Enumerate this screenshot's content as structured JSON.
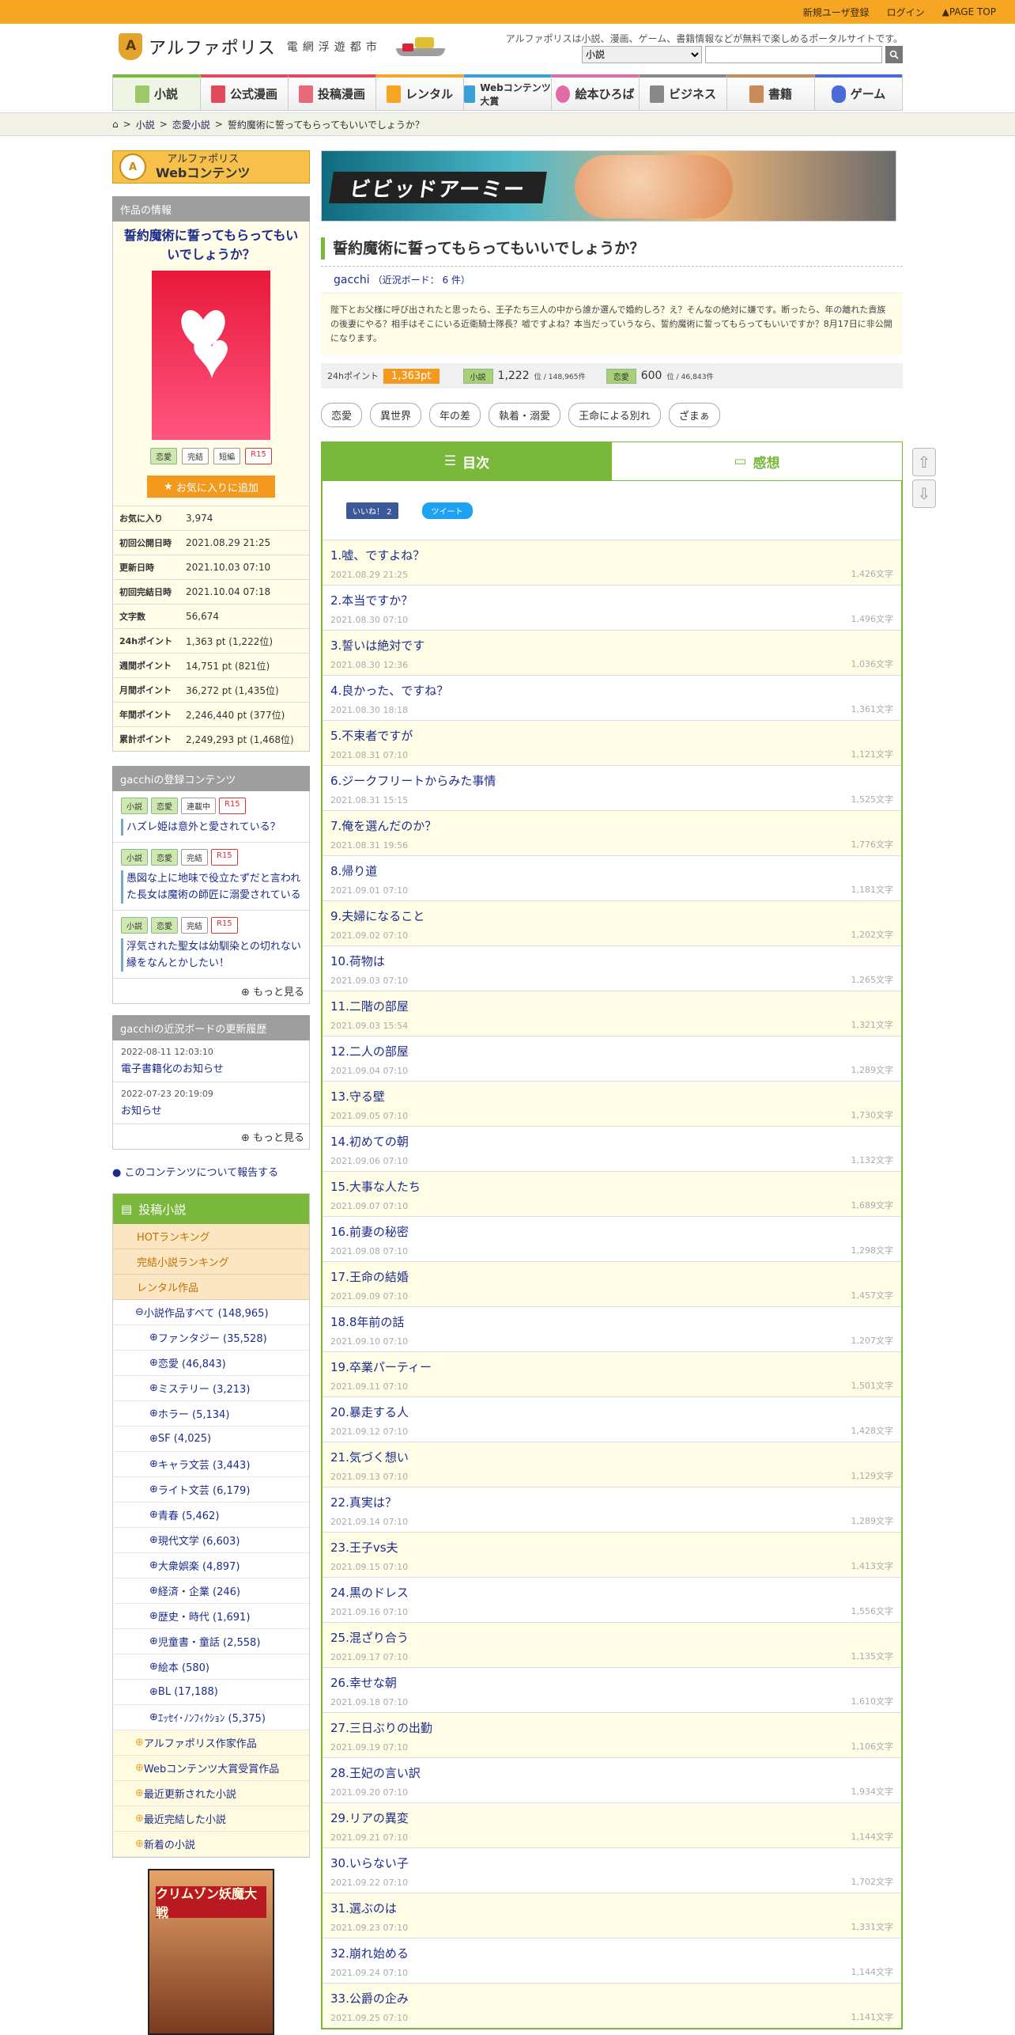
{
  "topbar": {
    "register": "新規ユーザ登録",
    "login": "ログイン",
    "pagetop": "PAGE TOP"
  },
  "header": {
    "logo_name": "アルファポリス",
    "logo_sub": "電網浮遊都市",
    "tagline": "アルファポリスは小説、漫画、ゲーム、書籍情報などが無料で楽しめるポータルサイトです。",
    "search_select": "小説",
    "search_placeholder": ""
  },
  "gnav": [
    "小説",
    "公式漫画",
    "投稿漫画",
    "レンタル",
    "Webコンテンツ大賞",
    "絵本ひろば",
    "ビジネス",
    "書籍",
    "ゲーム"
  ],
  "breadcrumb": {
    "sep": ">",
    "items": [
      "小説",
      "恋愛小説",
      "誓約魔術に誓ってもらってもいいでしょうか？"
    ]
  },
  "left": {
    "webcontents": {
      "line1": "アルファポリス",
      "line2": "Webコンテンツ"
    },
    "info_head": "作品の情報",
    "title": "誓約魔術に誓ってもらってもいいでしょうか？",
    "tags": [
      "恋愛",
      "完結",
      "短編",
      "R15"
    ],
    "fav_button": "お気に入りに追加",
    "stats": [
      {
        "k": "お気に入り",
        "v": "3,974"
      },
      {
        "k": "初回公開日時",
        "v": "2021.08.29 21:25"
      },
      {
        "k": "更新日時",
        "v": "2021.10.03 07:10"
      },
      {
        "k": "初回完結日時",
        "v": "2021.10.04 07:18"
      },
      {
        "k": "文字数",
        "v": "56,674"
      },
      {
        "k": "24hポイント",
        "v": "1,363 pt (1,222位)"
      },
      {
        "k": "週間ポイント",
        "v": "14,751 pt (821位)"
      },
      {
        "k": "月間ポイント",
        "v": "36,272 pt (1,435位)"
      },
      {
        "k": "年間ポイント",
        "v": "2,246,440 pt (377位)"
      },
      {
        "k": "累計ポイント",
        "v": "2,249,293 pt (1,468位)"
      }
    ],
    "reg_head": "gacchiの登録コンテンツ",
    "reg": [
      {
        "tags": [
          "小説",
          "恋愛",
          "連載中",
          "R15"
        ],
        "title": "ハズレ姫は意外と愛されている？"
      },
      {
        "tags": [
          "小説",
          "恋愛",
          "完結",
          "R15"
        ],
        "title": "愚図な上に地味で役立たずだと言われた長女は魔術の師匠に溺愛されている"
      },
      {
        "tags": [
          "小説",
          "恋愛",
          "完結",
          "R15"
        ],
        "title": "浮気された聖女は幼馴染との切れない縁をなんとかしたい！"
      }
    ],
    "more": "もっと見る",
    "bb_head": "gacchiの近況ボードの更新履歴",
    "bb": [
      {
        "d": "2022-08-11 12:03:10",
        "t": "電子書籍化のお知らせ"
      },
      {
        "d": "2022-07-23 20:19:09",
        "t": "お知らせ"
      }
    ],
    "report": "このコンテンツについて報告する",
    "nov_head": "投稿小説",
    "ranks": [
      "HOTランキング",
      "完結小説ランキング",
      "レンタル作品"
    ],
    "all": "小説作品すべて (148,965)",
    "cats": [
      "ファンタジー (35,528)",
      "恋愛 (46,843)",
      "ミステリー (3,213)",
      "ホラー (5,134)",
      "SF (4,025)",
      "キャラ文芸 (3,443)",
      "ライト文芸 (6,179)",
      "青春 (5,462)",
      "現代文学 (6,603)",
      "大衆娯楽 (4,897)",
      "経済・企業 (246)",
      "歴史・時代 (1,691)",
      "児童書・童話 (2,558)",
      "絵本 (580)",
      "BL (17,188)",
      "ｴｯｾｲ･ﾉﾝﾌｨｸｼｮﾝ (5,375)"
    ],
    "bottom": [
      "アルファポリス作家作品",
      "Webコンテンツ大賞受賞作品",
      "最近更新された小説",
      "最近完結した小説",
      "新着の小説"
    ],
    "banner": "クリムゾン妖魔大戦"
  },
  "main": {
    "ad": "ビビッドアーミー",
    "title": "誓約魔術に誓ってもらってもいいでしょうか？",
    "author": "gacchi",
    "author_board": "（近況ボード： 6 件）",
    "intro": "陛下とお父様に呼び出されたと思ったら、王子たち三人の中から誰か選んで婚約しろ？え？そんなの絶対に嫌です。断ったら、年の離れた貴族の後妻にやる？相手はそこにいる近衛騎士隊長？嘘ですよね？本当だっていうなら、誓約魔術に誓ってもらってもいいですか？8月17日に非公開になります。",
    "pt_label": "24hポイント",
    "pt": "1,363pt",
    "rank1": {
      "label": "小説",
      "v": "1,222",
      "unit": "位 / 148,965件"
    },
    "rank2": {
      "label": "恋愛",
      "v": "600",
      "unit": "位 / 46,843件"
    },
    "tags": [
      "恋愛",
      "異世界",
      "年の差",
      "執着・溺愛",
      "王命による別れ",
      "ざまぁ"
    ],
    "tab_toc": "目次",
    "tab_review": "感想",
    "fb": "いいね！ 2",
    "tw": "ツイート",
    "episodes": [
      {
        "t": "1.嘘、ですよね？",
        "d": "2021.08.29 21:25",
        "c": "1,426文字"
      },
      {
        "t": "2.本当ですか？",
        "d": "2021.08.30 07:10",
        "c": "1,496文字"
      },
      {
        "t": "3.誓いは絶対です",
        "d": "2021.08.30 12:36",
        "c": "1,036文字"
      },
      {
        "t": "4.良かった、ですね？",
        "d": "2021.08.30 18:18",
        "c": "1,361文字"
      },
      {
        "t": "5.不束者ですが",
        "d": "2021.08.31 07:10",
        "c": "1,121文字"
      },
      {
        "t": "6.ジークフリートからみた事情",
        "d": "2021.08.31 15:15",
        "c": "1,525文字"
      },
      {
        "t": "7.俺を選んだのか？",
        "d": "2021.08.31 19:56",
        "c": "1,776文字"
      },
      {
        "t": "8.帰り道",
        "d": "2021.09.01 07:10",
        "c": "1,181文字"
      },
      {
        "t": "9.夫婦になること",
        "d": "2021.09.02 07:10",
        "c": "1,202文字"
      },
      {
        "t": "10.荷物は",
        "d": "2021.09.03 07:10",
        "c": "1,265文字"
      },
      {
        "t": "11.二階の部屋",
        "d": "2021.09.03 15:54",
        "c": "1,321文字"
      },
      {
        "t": "12.二人の部屋",
        "d": "2021.09.04 07:10",
        "c": "1,289文字"
      },
      {
        "t": "13.守る壁",
        "d": "2021.09.05 07:10",
        "c": "1,730文字"
      },
      {
        "t": "14.初めての朝",
        "d": "2021.09.06 07:10",
        "c": "1,132文字"
      },
      {
        "t": "15.大事な人たち",
        "d": "2021.09.07 07:10",
        "c": "1,689文字"
      },
      {
        "t": "16.前妻の秘密",
        "d": "2021.09.08 07:10",
        "c": "1,298文字"
      },
      {
        "t": "17.王命の結婚",
        "d": "2021.09.09 07:10",
        "c": "1,457文字"
      },
      {
        "t": "18.8年前の話",
        "d": "2021.09.10 07:10",
        "c": "1,207文字"
      },
      {
        "t": "19.卒業パーティー",
        "d": "2021.09.11 07:10",
        "c": "1,501文字"
      },
      {
        "t": "20.暴走する人",
        "d": "2021.09.12 07:10",
        "c": "1,428文字"
      },
      {
        "t": "21.気づく想い",
        "d": "2021.09.13 07:10",
        "c": "1,129文字"
      },
      {
        "t": "22.真実は？",
        "d": "2021.09.14 07:10",
        "c": "1,289文字"
      },
      {
        "t": "23.王子vs夫",
        "d": "2021.09.15 07:10",
        "c": "1,413文字"
      },
      {
        "t": "24.黒のドレス",
        "d": "2021.09.16 07:10",
        "c": "1,556文字"
      },
      {
        "t": "25.混ざり合う",
        "d": "2021.09.17 07:10",
        "c": "1,135文字"
      },
      {
        "t": "26.幸せな朝",
        "d": "2021.09.18 07:10",
        "c": "1,610文字"
      },
      {
        "t": "27.三日ぶりの出勤",
        "d": "2021.09.19 07:10",
        "c": "1,106文字"
      },
      {
        "t": "28.王妃の言い訳",
        "d": "2021.09.20 07:10",
        "c": "1,934文字"
      },
      {
        "t": "29.リアの異変",
        "d": "2021.09.21 07:10",
        "c": "1,144文字"
      },
      {
        "t": "30.いらない子",
        "d": "2021.09.22 07:10",
        "c": "1,702文字"
      },
      {
        "t": "31.選ぶのは",
        "d": "2021.09.23 07:10",
        "c": "1,331文字"
      },
      {
        "t": "32.崩れ始める",
        "d": "2021.09.24 07:10",
        "c": "1,144文字"
      },
      {
        "t": "33.公爵の企み",
        "d": "2021.09.25 07:10",
        "c": "1,141文字"
      }
    ]
  },
  "colors": {
    "accent_orange": "#f6a623",
    "green": "#79b83b",
    "link": "#1b2c8a"
  },
  "icons": [
    "home-icon",
    "search-icon",
    "star-icon",
    "arrow-up-icon",
    "arrow-down-icon",
    "book-icon",
    "chat-icon"
  ]
}
